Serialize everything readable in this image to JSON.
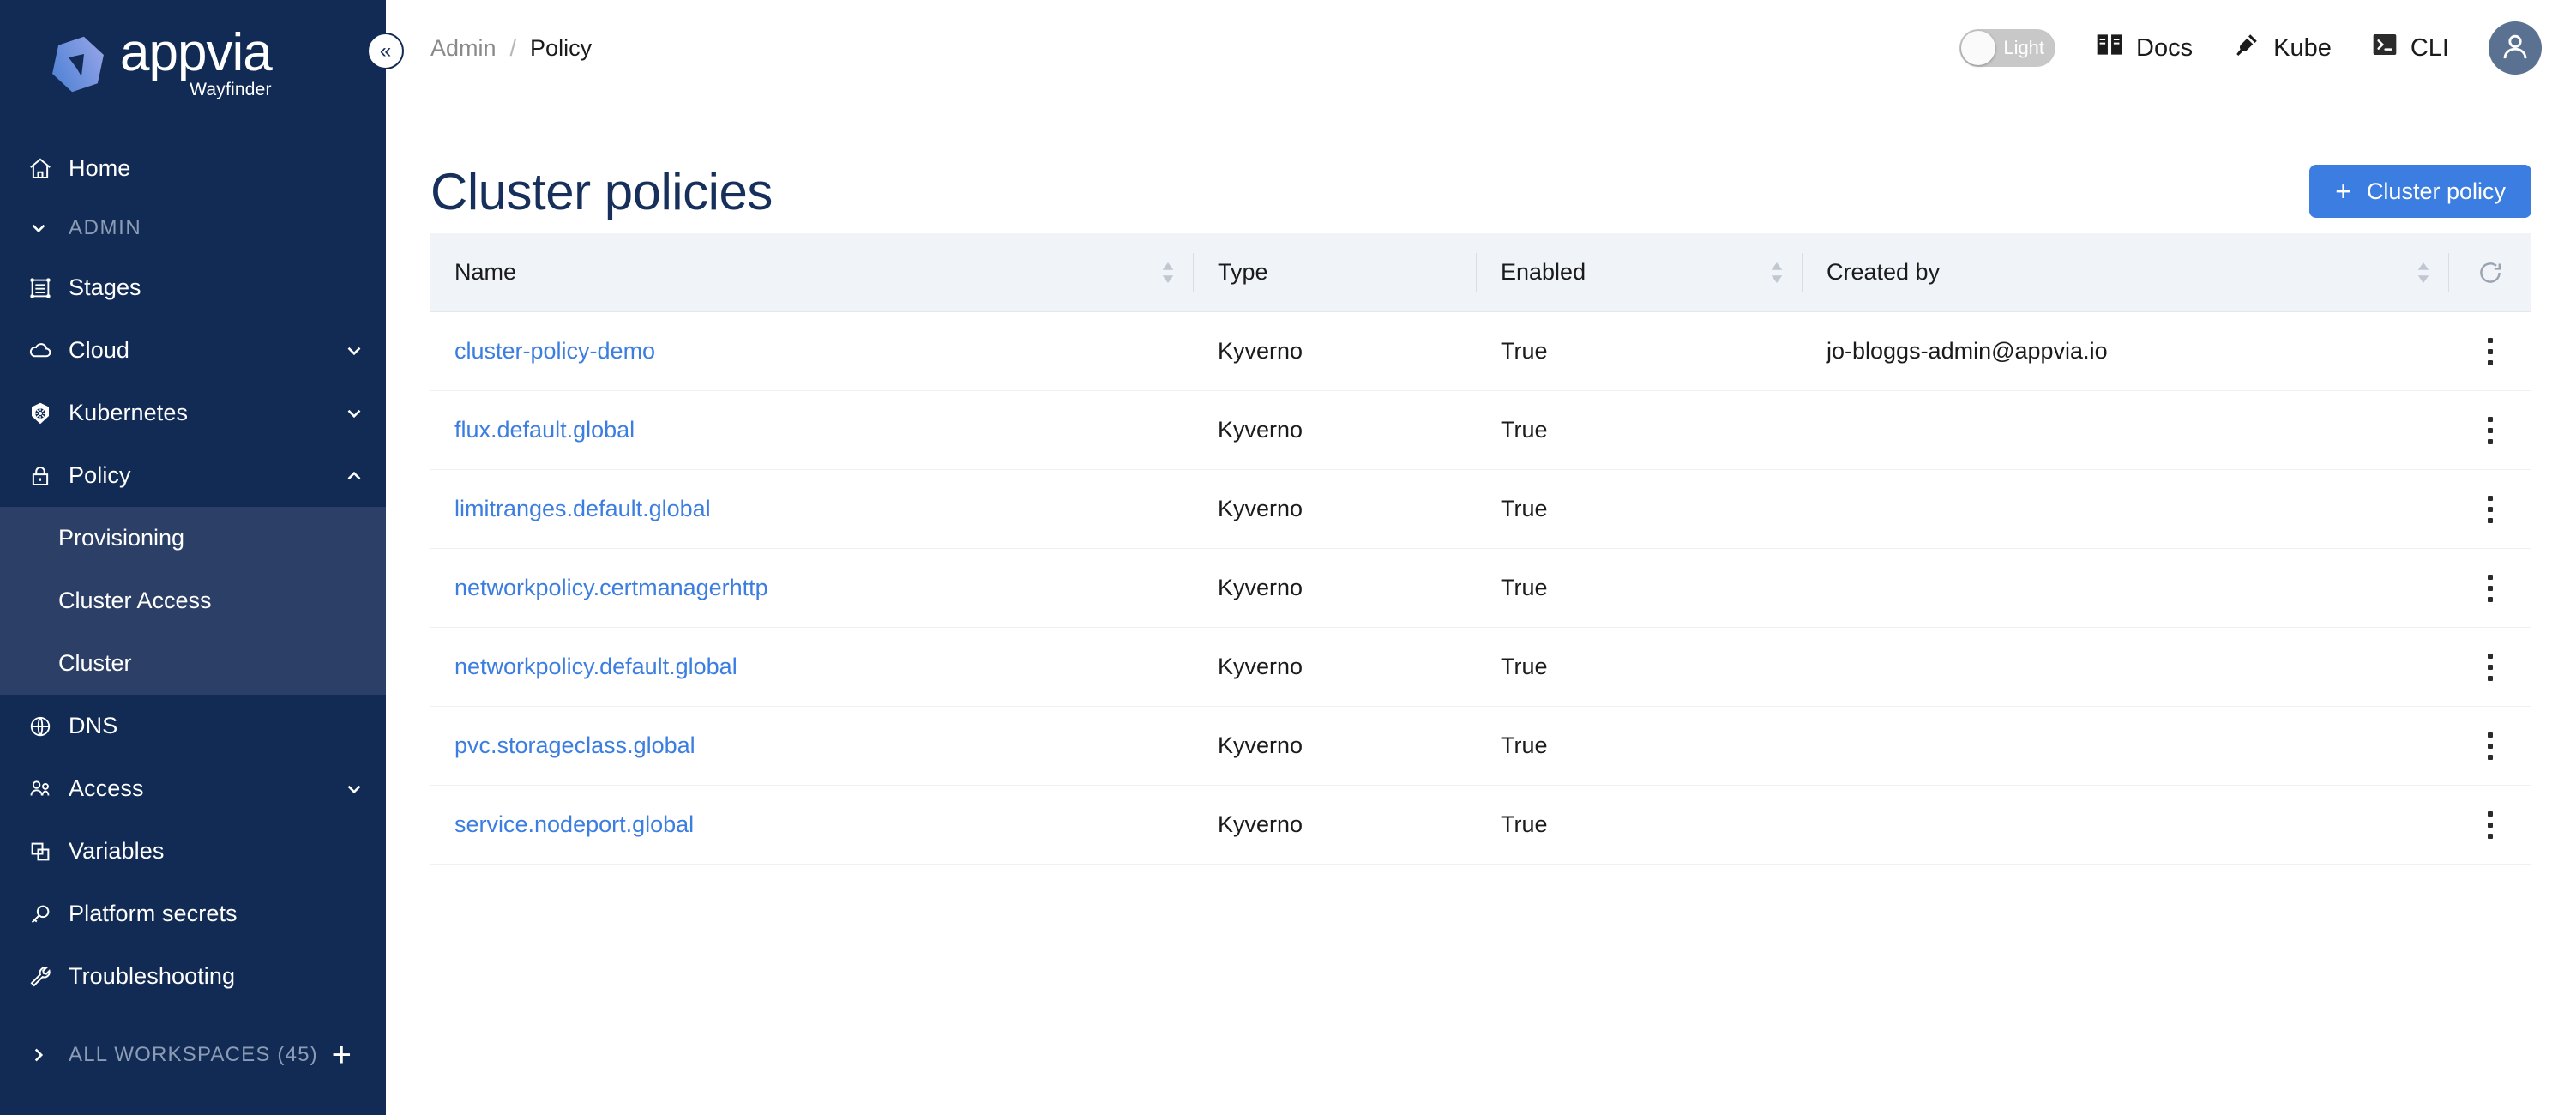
{
  "brand": {
    "name": "appvia",
    "product": "Wayfinder",
    "logo_icon": "appvia-hexagon-logo",
    "collapse_icon": "double-chevron-left-icon"
  },
  "sidebar": {
    "items": [
      {
        "label": "Home",
        "icon": "home-icon",
        "type": "item",
        "chevron": ""
      },
      {
        "label": "ADMIN",
        "icon": "",
        "type": "group",
        "chevron": "chevron-down-icon"
      },
      {
        "label": "Stages",
        "icon": "stages-icon",
        "type": "item",
        "chevron": ""
      },
      {
        "label": "Cloud",
        "icon": "cloud-icon",
        "type": "item",
        "chevron": "chevron-down-icon"
      },
      {
        "label": "Kubernetes",
        "icon": "kubernetes-icon",
        "type": "item",
        "chevron": "chevron-down-icon"
      },
      {
        "label": "Policy",
        "icon": "lock-icon",
        "type": "item",
        "chevron": "chevron-up-icon"
      },
      {
        "label": "Provisioning",
        "icon": "",
        "type": "sub",
        "chevron": ""
      },
      {
        "label": "Cluster Access",
        "icon": "",
        "type": "sub",
        "chevron": ""
      },
      {
        "label": "Cluster",
        "icon": "",
        "type": "sub",
        "chevron": ""
      },
      {
        "label": "DNS",
        "icon": "globe-icon",
        "type": "item",
        "chevron": ""
      },
      {
        "label": "Access",
        "icon": "users-icon",
        "type": "item",
        "chevron": "chevron-down-icon"
      },
      {
        "label": "Variables",
        "icon": "copy-icon",
        "type": "item",
        "chevron": ""
      },
      {
        "label": "Platform secrets",
        "icon": "key-icon",
        "type": "item",
        "chevron": ""
      },
      {
        "label": "Troubleshooting",
        "icon": "wrench-icon",
        "type": "item",
        "chevron": ""
      }
    ],
    "workspaces": {
      "label": "ALL WORKSPACES (45)",
      "chevron_icon": "chevron-right-icon",
      "add_icon": "plus-icon"
    }
  },
  "topbar": {
    "breadcrumb": {
      "parent": "Admin",
      "separator": "/",
      "current": "Policy"
    },
    "theme_toggle": {
      "label": "Light",
      "state": "off"
    },
    "links": [
      {
        "label": "Docs",
        "icon": "book-icon"
      },
      {
        "label": "Kube",
        "icon": "kube-plug-icon"
      },
      {
        "label": "CLI",
        "icon": "terminal-icon"
      }
    ],
    "avatar_icon": "user-avatar-icon"
  },
  "page": {
    "title": "Cluster policies",
    "primary_action": {
      "label": "Cluster policy",
      "icon": "plus-icon"
    }
  },
  "table": {
    "columns": [
      {
        "key": "name",
        "label": "Name",
        "sortable": true
      },
      {
        "key": "type",
        "label": "Type",
        "sortable": false
      },
      {
        "key": "enabled",
        "label": "Enabled",
        "sortable": true
      },
      {
        "key": "created_by",
        "label": "Created by",
        "sortable": true
      }
    ],
    "refresh_icon": "refresh-icon",
    "row_menu_icon": "kebab-menu-icon",
    "rows": [
      {
        "name": "cluster-policy-demo",
        "type": "Kyverno",
        "enabled": "True",
        "created_by": "jo-bloggs-admin@appvia.io"
      },
      {
        "name": "flux.default.global",
        "type": "Kyverno",
        "enabled": "True",
        "created_by": ""
      },
      {
        "name": "limitranges.default.global",
        "type": "Kyverno",
        "enabled": "True",
        "created_by": ""
      },
      {
        "name": "networkpolicy.certmanagerhttp",
        "type": "Kyverno",
        "enabled": "True",
        "created_by": ""
      },
      {
        "name": "networkpolicy.default.global",
        "type": "Kyverno",
        "enabled": "True",
        "created_by": ""
      },
      {
        "name": "pvc.storageclass.global",
        "type": "Kyverno",
        "enabled": "True",
        "created_by": ""
      },
      {
        "name": "service.nodeport.global",
        "type": "Kyverno",
        "enabled": "True",
        "created_by": ""
      }
    ]
  },
  "colors": {
    "sidebar_bg": "#122B55",
    "sidebar_active": "#2C3F66",
    "accent_blue": "#3B7DE0",
    "title_navy": "#17305B",
    "table_header_bg": "#F0F4F9"
  }
}
